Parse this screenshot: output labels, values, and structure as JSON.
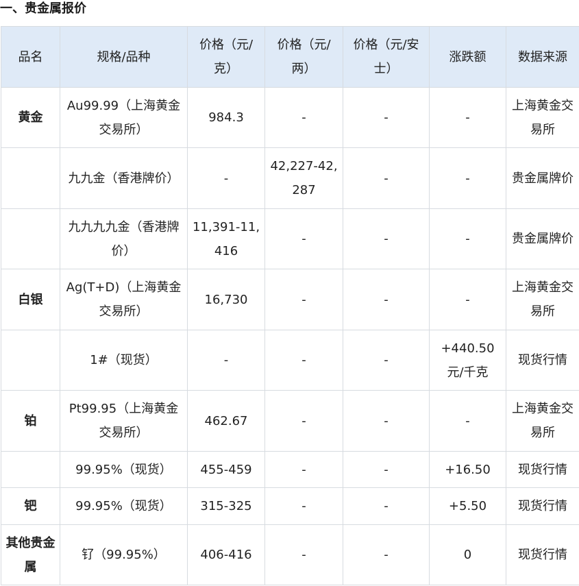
{
  "section_title": "一、贵金属报价",
  "headers": [
    "品名",
    "规格/品种",
    "价格（元/克）",
    "价格（元/两）",
    "价格（元/安士）",
    "涨跌额",
    "数据来源"
  ],
  "rows": [
    [
      "黄金",
      "Au99.99（上海黄金交易所）",
      "984.3",
      "-",
      "-",
      "-",
      "上海黄金交易所"
    ],
    [
      "",
      "九九金（香港牌价）",
      "-",
      "42,227-42,287",
      "-",
      "-",
      "贵金属牌价"
    ],
    [
      "",
      "九九九九金（香港牌价）",
      "11,391-11,416",
      "-",
      "-",
      "-",
      "贵金属牌价"
    ],
    [
      "白银",
      "Ag(T+D)（上海黄金交易所）",
      "16,730",
      "-",
      "-",
      "-",
      "上海黄金交易所"
    ],
    [
      "",
      "1#（现货）",
      "-",
      "-",
      "-",
      "+440.50元/千克",
      "现货行情"
    ],
    [
      "铂",
      "Pt99.95（上海黄金交易所）",
      "462.67",
      "-",
      "-",
      "-",
      "上海黄金交易所"
    ],
    [
      "",
      "99.95%（现货）",
      "455-459",
      "-",
      "-",
      "+16.50",
      "现货行情"
    ],
    [
      "钯",
      "99.95%（现货）",
      "315-325",
      "-",
      "-",
      "+5.50",
      "现货行情"
    ],
    [
      "其他贵金属",
      "钌（99.95%）",
      "406-416",
      "-",
      "-",
      "0",
      "现货行情"
    ]
  ]
}
